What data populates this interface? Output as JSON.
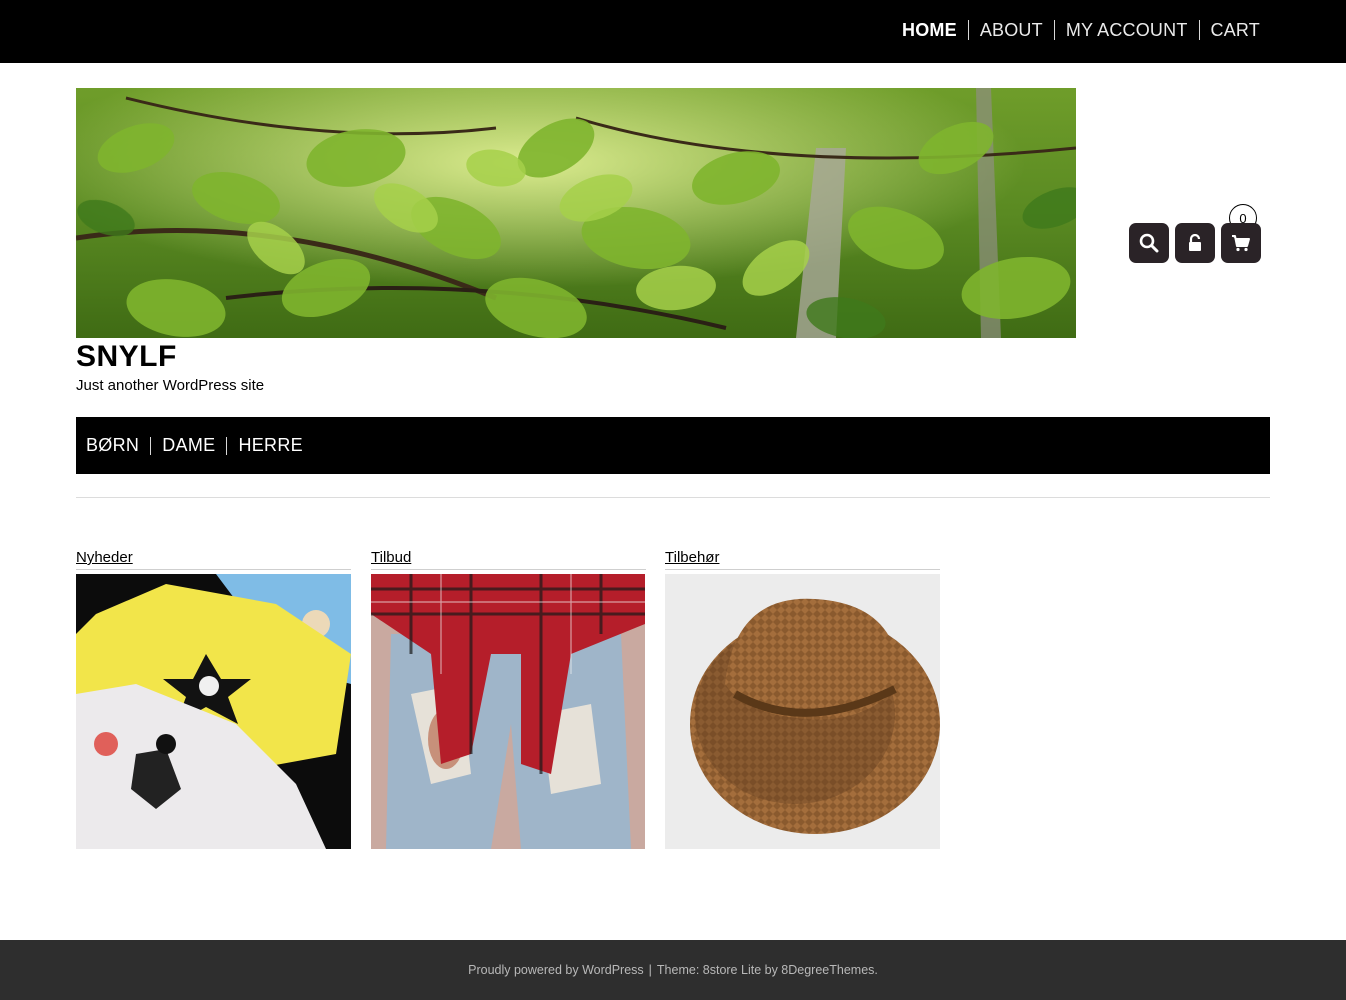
{
  "top_nav": {
    "items": [
      {
        "label": "HOME",
        "active": true
      },
      {
        "label": "ABOUT",
        "active": false
      },
      {
        "label": "MY ACCOUNT",
        "active": false
      },
      {
        "label": "CART",
        "active": false
      }
    ]
  },
  "header": {
    "site_title": "SNYLF",
    "tagline": "Just another WordPress site",
    "cart_count": "0",
    "icons": [
      "search-icon",
      "unlock-icon",
      "cart-icon"
    ],
    "icon_button_color": "#2a2327"
  },
  "category_nav": {
    "items": [
      "BØRN",
      "DAME",
      "HERRE"
    ]
  },
  "products": [
    {
      "title": "Nyheder",
      "image": "baby-bodysuits-image"
    },
    {
      "title": "Tilbud",
      "image": "ripped-jeans-image"
    },
    {
      "title": "Tilbehør",
      "image": "wicker-hat-image"
    }
  ],
  "footer": {
    "powered_text": "Proudly powered by WordPress",
    "separator": "|",
    "theme_text": "Theme: 8store Lite by 8DegreeThemes."
  }
}
